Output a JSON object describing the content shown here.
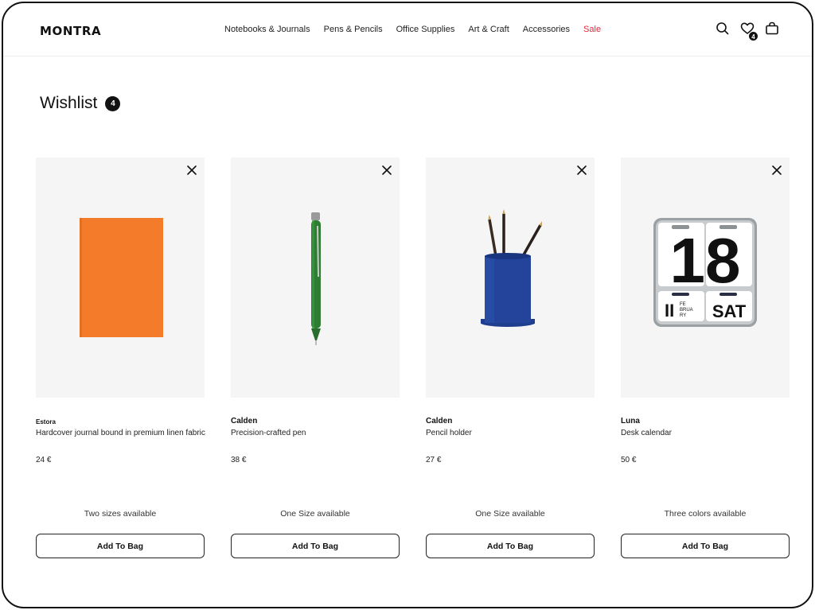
{
  "brand": {
    "logo": "MONTRA"
  },
  "nav": {
    "items": [
      "Notebooks & Journals",
      "Pens & Pencils",
      "Office Supplies",
      "Art & Craft",
      "Accessories"
    ],
    "sale": "Sale",
    "sale_color": "#e0293e"
  },
  "header_icons": {
    "search": "search-icon",
    "wishlist": "heart-icon",
    "wishlist_count": "4",
    "bag": "shopping-bag-icon"
  },
  "wishlist": {
    "title": "Wishlist",
    "count": "4"
  },
  "products": [
    {
      "brand": "Estora",
      "name": "Hardcover journal bound in premium linen fabric",
      "price": "24 €",
      "availability": "Two sizes available",
      "button": "Add To Bag",
      "image": "orange-notebook"
    },
    {
      "brand": "Calden",
      "name": "Precision-crafted pen",
      "price": "38 €",
      "availability": "One Size available",
      "button": "Add To Bag",
      "image": "green-pen"
    },
    {
      "brand": "Calden",
      "name": "Pencil holder",
      "price": "27 €",
      "availability": "One Size available",
      "button": "Add To Bag",
      "image": "blue-pencil-holder"
    },
    {
      "brand": "Luna",
      "name": "Desk calendar",
      "price": "50 €",
      "availability": "Three colors available",
      "button": "Add To Bag",
      "image": "flip-desk-calendar",
      "calendar": {
        "day": "18",
        "month_prefix": "II",
        "month_lines": [
          "FE",
          "BRUA",
          "RY"
        ],
        "weekday": "SAT"
      }
    }
  ]
}
